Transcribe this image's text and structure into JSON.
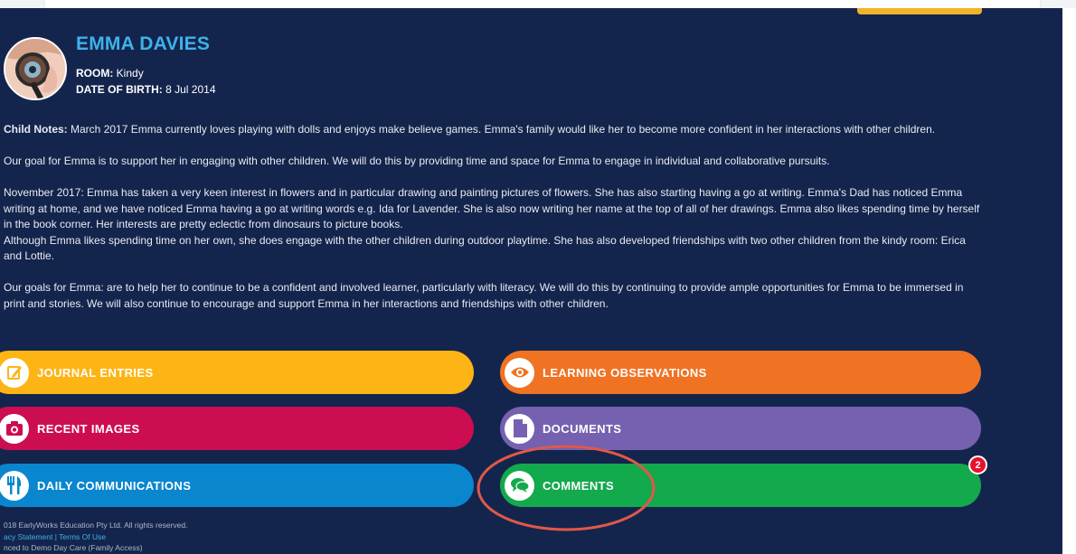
{
  "child": {
    "name": "EMMA DAVIES",
    "room_label": "ROOM:",
    "room": "Kindy",
    "dob_label": "DATE OF BIRTH:",
    "dob": "8 Jul 2014"
  },
  "notes": {
    "label": "Child Notes:",
    "p1": "March 2017 Emma currently loves playing with dolls and enjoys make believe games. Emma's family would like her to become more confident in her interactions with other children.",
    "p2": "Our goal for Emma is to support her in engaging with other children. We will do this by providing time and space for Emma to engage in individual and collaborative pursuits.",
    "p3": "November 2017: Emma has taken a very keen interest in flowers and in particular drawing and painting pictures of flowers. She has also starting having a go at writing. Emma's Dad has noticed Emma writing at home, and we have noticed Emma having a go at writing words e.g. Ida for Lavender. She is also now writing her name at the top of all of her drawings. Emma also likes spending time by herself in the book corner. Her interests are pretty eclectic from dinosaurs to picture books.",
    "p4": "Although Emma likes spending time on her own, she does engage with the other children during outdoor playtime. She has also developed friendships with two other children from the kindy room: Erica and Lottie.",
    "p5": "Our goals for Emma: are to help her to continue to be a confident and involved learner, particularly with literacy. We will do this by continuing to provide ample opportunities for Emma to be immersed in print and stories. We will also continue to encourage and support Emma in her interactions and friendships with other children."
  },
  "tiles": {
    "journal": {
      "label": "JOURNAL ENTRIES",
      "color": "#fdb515",
      "icon": "pencil-icon"
    },
    "learning": {
      "label": "LEARNING OBSERVATIONS",
      "color": "#f07223",
      "icon": "eye-icon"
    },
    "images": {
      "label": "RECENT IMAGES",
      "color": "#cc0d52",
      "icon": "camera-icon"
    },
    "documents": {
      "label": "DOCUMENTS",
      "color": "#7661b0",
      "icon": "document-icon"
    },
    "daily": {
      "label": "DAILY COMMUNICATIONS",
      "color": "#0a86cf",
      "icon": "cutlery-icon"
    },
    "comments": {
      "label": "COMMENTS",
      "color": "#13a94d",
      "icon": "speech-bubbles-icon",
      "badge": "2"
    }
  },
  "footer": {
    "copyright": "018 EarlyWorks Education Pty Ltd. All rights reserved.",
    "privacy": "acy Statement",
    "separator": " | ",
    "terms": "Terms Of Use",
    "connected": "nced to Demo Day Care (Family Access)"
  },
  "colors": {
    "background": "#14254d",
    "name": "#3eb2ea",
    "annotation": "#e0584a"
  }
}
